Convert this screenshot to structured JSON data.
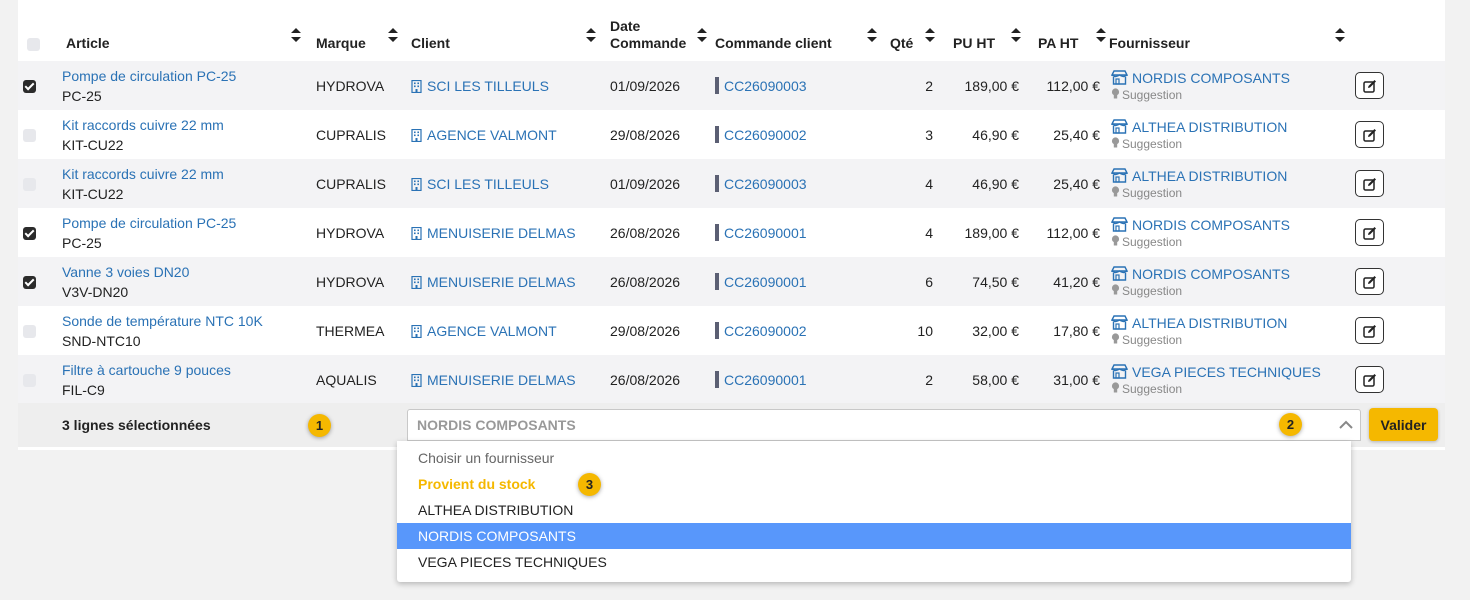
{
  "table": {
    "headers": {
      "article": "Article",
      "marque": "Marque",
      "client": "Client",
      "date_l1": "Date",
      "date_l2": "Commande",
      "commande_client": "Commande client",
      "qte": "Qté",
      "pu_ht": "PU HT",
      "pa_ht": "PA HT",
      "fournisseur": "Fournisseur"
    },
    "rows": [
      {
        "checked": true,
        "article": "Pompe de circulation PC-25",
        "ref": "PC-25",
        "marque": "HYDROVA",
        "client": "SCI LES TILLEULS",
        "date": "01/09/2026",
        "commande": "CC26090003",
        "qte": "2",
        "pu_ht": "189,00 €",
        "pa_ht": "112,00 €",
        "fournisseur": "NORDIS COMPOSANTS",
        "suggestion": "Suggestion"
      },
      {
        "checked": false,
        "article": "Kit raccords cuivre 22 mm",
        "ref": "KIT-CU22",
        "marque": "CUPRALIS",
        "client": "AGENCE VALMONT",
        "date": "29/08/2026",
        "commande": "CC26090002",
        "qte": "3",
        "pu_ht": "46,90 €",
        "pa_ht": "25,40 €",
        "fournisseur": "ALTHEA DISTRIBUTION",
        "suggestion": "Suggestion"
      },
      {
        "checked": false,
        "article": "Kit raccords cuivre 22 mm",
        "ref": "KIT-CU22",
        "marque": "CUPRALIS",
        "client": "SCI LES TILLEULS",
        "date": "01/09/2026",
        "commande": "CC26090003",
        "qte": "4",
        "pu_ht": "46,90 €",
        "pa_ht": "25,40 €",
        "fournisseur": "ALTHEA DISTRIBUTION",
        "suggestion": "Suggestion"
      },
      {
        "checked": true,
        "article": "Pompe de circulation PC-25",
        "ref": "PC-25",
        "marque": "HYDROVA",
        "client": "MENUISERIE DELMAS",
        "date": "26/08/2026",
        "commande": "CC26090001",
        "qte": "4",
        "pu_ht": "189,00 €",
        "pa_ht": "112,00 €",
        "fournisseur": "NORDIS COMPOSANTS",
        "suggestion": "Suggestion"
      },
      {
        "checked": true,
        "article": "Vanne 3 voies DN20",
        "ref": "V3V-DN20",
        "marque": "HYDROVA",
        "client": "MENUISERIE DELMAS",
        "date": "26/08/2026",
        "commande": "CC26090001",
        "qte": "6",
        "pu_ht": "74,50 €",
        "pa_ht": "41,20 €",
        "fournisseur": "NORDIS COMPOSANTS",
        "suggestion": "Suggestion"
      },
      {
        "checked": false,
        "article": "Sonde de température NTC 10K",
        "ref": "SND-NTC10",
        "marque": "THERMEA",
        "client": "AGENCE VALMONT",
        "date": "29/08/2026",
        "commande": "CC26090002",
        "qte": "10",
        "pu_ht": "32,00 €",
        "pa_ht": "17,80 €",
        "fournisseur": "ALTHEA DISTRIBUTION",
        "suggestion": "Suggestion"
      },
      {
        "checked": false,
        "article": "Filtre à cartouche 9 pouces",
        "ref": "FIL-C9",
        "marque": "AQUALIS",
        "client": "MENUISERIE DELMAS",
        "date": "26/08/2026",
        "commande": "CC26090001",
        "qte": "2",
        "pu_ht": "58,00 €",
        "pa_ht": "31,00 €",
        "fournisseur": "VEGA PIECES TECHNIQUES",
        "suggestion": "Suggestion"
      }
    ]
  },
  "footer": {
    "selection_text": "3 lignes sélectionnées",
    "select_value": "NORDIS COMPOSANTS",
    "validate_label": "Valider"
  },
  "badges": {
    "b1": "1",
    "b2": "2",
    "b3": "3"
  },
  "dropdown": {
    "placeholder": "Choisir un fournisseur",
    "stock_option": "Provient du stock",
    "options": [
      "ALTHEA DISTRIBUTION",
      "NORDIS COMPOSANTS",
      "VEGA PIECES TECHNIQUES"
    ],
    "selected": "NORDIS COMPOSANTS"
  },
  "colors": {
    "link": "#2a72b5",
    "accent": "#f5b800",
    "highlight": "#5897fb",
    "checkbox_checked": "#2b2b2b",
    "checkbox_unchecked": "#e7e8ec"
  },
  "icons": {
    "sort": "sort-arrows-icon",
    "client": "building-icon",
    "supplier": "store-icon",
    "suggestion": "lightbulb-icon",
    "edit": "edit-icon",
    "chevron": "chevron-up-icon"
  }
}
